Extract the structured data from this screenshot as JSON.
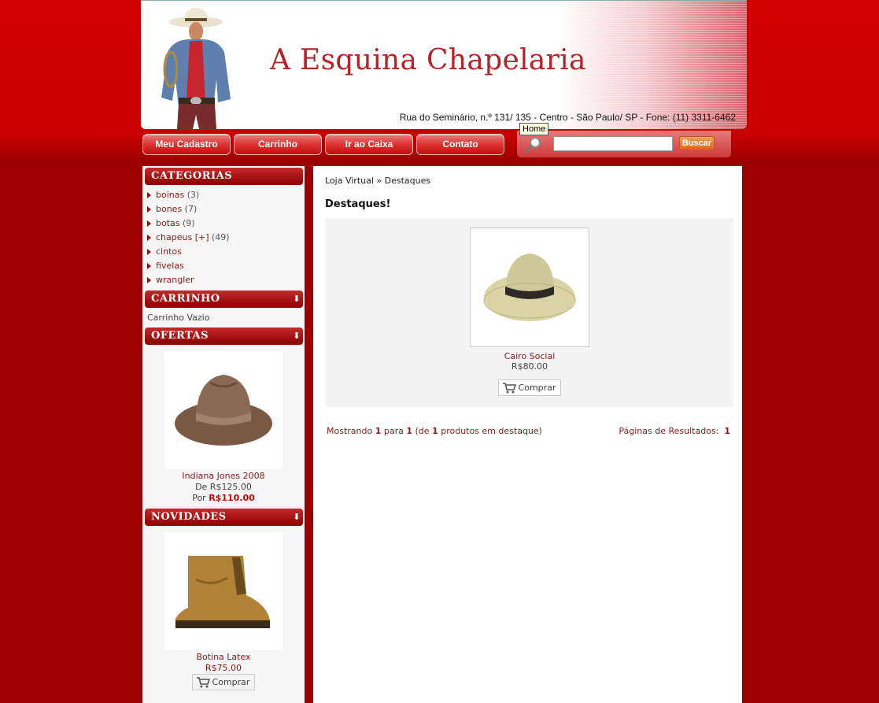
{
  "header": {
    "title": "A Esquina Chapelaria",
    "address": "Rua do Seminário, n.º 131/ 135 - Centro - São Paulo/ SP - Fone: (11) 3311-6462",
    "colors": {
      "brand_red": "#b3232a",
      "background": "#c90000"
    }
  },
  "nav": {
    "items": [
      "Meu Cadastro",
      "Carrinho",
      "Ir ao Caixa",
      "Contato"
    ],
    "tooltip": "Home"
  },
  "search": {
    "placeholder": "",
    "button": "Buscar"
  },
  "sidebar": {
    "categories_title": "CATEGORIAS",
    "categories": [
      {
        "name": "boinas",
        "count": " (3)"
      },
      {
        "name": "bones",
        "count": " (7)"
      },
      {
        "name": "botas",
        "count": " (9)"
      },
      {
        "name": "chapeus",
        "extra": " [+]",
        "count": " (49)"
      },
      {
        "name": "cintos",
        "count": ""
      },
      {
        "name": "fivelas",
        "count": ""
      },
      {
        "name": "wrangler",
        "count": ""
      }
    ],
    "cart_title": "CARRINHO",
    "cart_empty": "Carrinho Vazio",
    "offers_title": "OFERTAS",
    "offer": {
      "name": "Indiana Jones 2008",
      "from": "De R$125.00",
      "by_label": "Por ",
      "by_price": "R$110.00"
    },
    "news_title": "NOVIDADES",
    "news": {
      "name": "Botina Latex",
      "price": "R$75.00",
      "buy": "Comprar"
    },
    "box_arrow": "⬇"
  },
  "main": {
    "breadcrumb": "Loja Virtual » Destaques",
    "title": "Destaques!",
    "product": {
      "name": "Cairo Social",
      "price": "R$80.00",
      "buy": "Comprar"
    },
    "showing": {
      "prefix": "Mostrando ",
      "from": "1",
      "mid1": " para ",
      "to": "1",
      "mid2": " (de ",
      "total": "1",
      "suffix": " produtos em destaque)"
    },
    "pages_label": "Páginas de Resultados:  ",
    "pages_current": "1"
  }
}
